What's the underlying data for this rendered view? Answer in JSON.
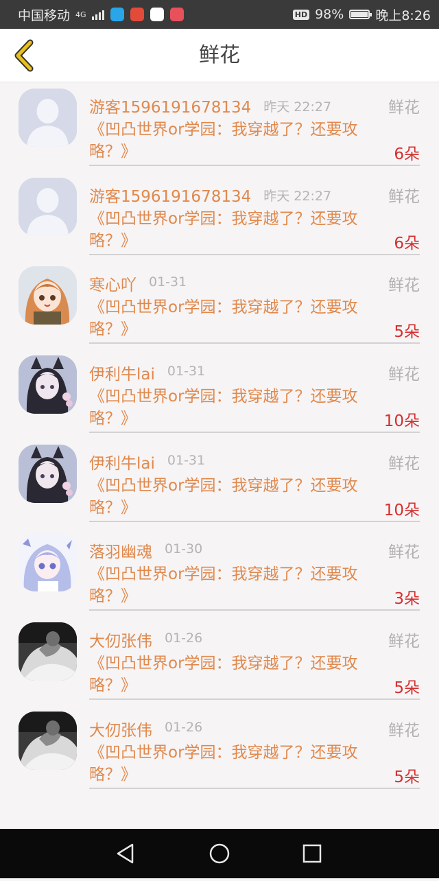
{
  "status": {
    "carrier": "中国移动",
    "network": "4G",
    "battery": "98%",
    "battery_level": 0.98,
    "time": "晚上8:26",
    "hd": "HD"
  },
  "header": {
    "title": "鲜花"
  },
  "items": [
    {
      "user": "游客1596191678134",
      "time": "昨天 22:27",
      "gift": "鲜花",
      "book": "《凹凸世界or学园：我穿越了？还要攻略？》",
      "count": "6朵",
      "avatar": "default"
    },
    {
      "user": "游客1596191678134",
      "time": "昨天 22:27",
      "gift": "鲜花",
      "book": "《凹凸世界or学园：我穿越了？还要攻略？》",
      "count": "6朵",
      "avatar": "default"
    },
    {
      "user": "寒心吖",
      "time": "01-31",
      "gift": "鲜花",
      "book": "《凹凸世界or学园：我穿越了？还要攻略？》",
      "count": "5朵",
      "avatar": "anime-girl-orange"
    },
    {
      "user": "伊利牛lai",
      "time": "01-31",
      "gift": "鲜花",
      "book": "《凹凸世界or学园：我穿越了？还要攻略？》",
      "count": "10朵",
      "avatar": "anime-dark"
    },
    {
      "user": "伊利牛lai",
      "time": "01-31",
      "gift": "鲜花",
      "book": "《凹凸世界or学园：我穿越了？还要攻略？》",
      "count": "10朵",
      "avatar": "anime-dark"
    },
    {
      "user": "落羽幽魂",
      "time": "01-30",
      "gift": "鲜花",
      "book": "《凹凸世界or学园：我穿越了？还要攻略？》",
      "count": "3朵",
      "avatar": "anime-girl-blue"
    },
    {
      "user": "大仞张伟",
      "time": "01-26",
      "gift": "鲜花",
      "book": "《凹凸世界or学园：我穿越了？还要攻略？》",
      "count": "5朵",
      "avatar": "photo-bw"
    },
    {
      "user": "大仞张伟",
      "time": "01-26",
      "gift": "鲜花",
      "book": "《凹凸世界or学园：我穿越了？还要攻略？》",
      "count": "5朵",
      "avatar": "photo-bw"
    }
  ],
  "colors": {
    "accent": "#e0894d",
    "count": "#d42f2f",
    "back_icon": "#e8c020"
  }
}
